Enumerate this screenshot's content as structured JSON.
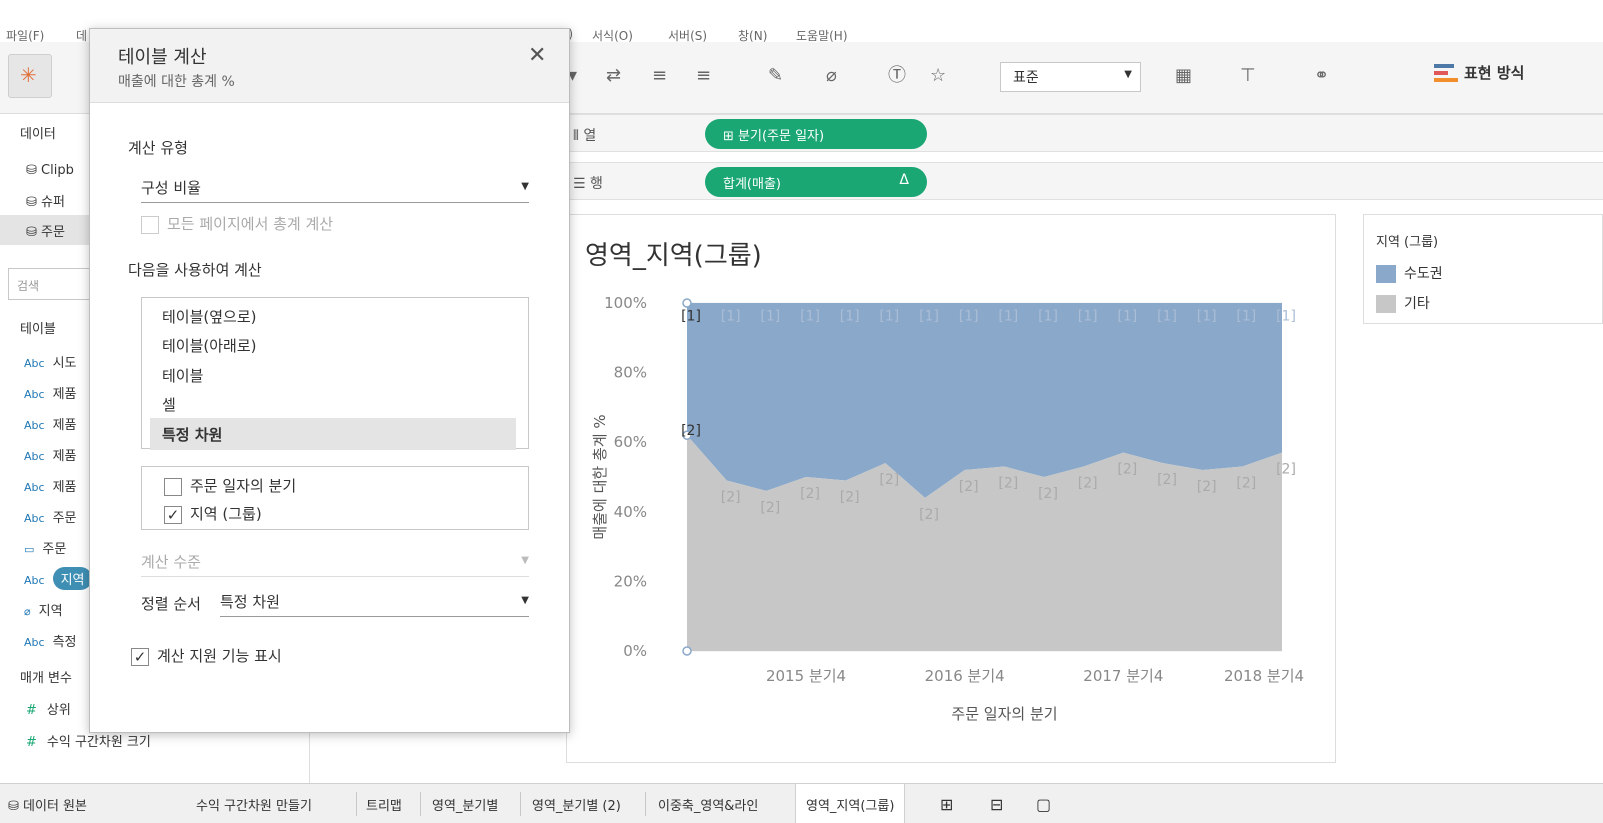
{
  "menu": [
    "파일(F)",
    "데",
    "M)",
    "서식(O)",
    "서버(S)",
    "창(N)",
    "도움말(H)"
  ],
  "toolbar": {
    "fit_select": "표준",
    "show_me": "표현 방식"
  },
  "data_pane": {
    "header": "데이터",
    "sources": [
      "Clipb",
      "슈퍼",
      "주문"
    ],
    "search_placeholder": "검색",
    "tables_header": "테이블",
    "type_abc": "Abc",
    "fields": [
      "시도",
      "제품",
      "제품",
      "제품",
      "제품",
      "주문",
      "주문",
      "지역",
      "지역",
      "측정"
    ],
    "params_header": "매개 변수",
    "params": [
      "상위",
      "수익 구간차원 크기"
    ]
  },
  "shelves": {
    "columns_label": "열",
    "rows_label": "행",
    "columns_pill": "분기(주문 일자)",
    "rows_pill": "합계(매출)",
    "rows_pill_delta": "Δ"
  },
  "chart_data": {
    "type": "area",
    "title": "영역_지역(그룹)",
    "xlabel": "주문 일자의 분기",
    "ylabel": "매출에 대한 총계 %",
    "yticks": [
      "0%",
      "20%",
      "40%",
      "60%",
      "80%",
      "100%"
    ],
    "xticks": [
      "2015 분기4",
      "2016 분기4",
      "2017 분기4",
      "2018 분기4"
    ],
    "ylim": [
      0,
      100
    ],
    "x_count": 16,
    "series": [
      {
        "name": "기타",
        "color": "#c7c7c7",
        "label": "[2]",
        "values": [
          62,
          49,
          46,
          50,
          49,
          54,
          44,
          52,
          53,
          50,
          53,
          57,
          54,
          52,
          53,
          57
        ]
      },
      {
        "name": "수도권",
        "color": "#8aa8c9",
        "label": "[1]",
        "values": [
          38,
          51,
          54,
          50,
          51,
          46,
          56,
          48,
          47,
          50,
          47,
          43,
          46,
          48,
          47,
          43
        ]
      }
    ]
  },
  "legend": {
    "title": "지역 (그룹)",
    "items": [
      {
        "label": "수도권",
        "color": "#8aa8c9"
      },
      {
        "label": "기타",
        "color": "#c7c7c7"
      }
    ]
  },
  "tabs": [
    "데이터 원본",
    "수익 구간차원 만들기",
    "트리맵",
    "영역_분기별",
    "영역_분기별 (2)",
    "이중축_영역&라인",
    "영역_지역(그룹)"
  ],
  "dialog": {
    "title": "테이블 계산",
    "subtitle": "매출에 대한 총계 %",
    "calc_type_label": "계산 유형",
    "calc_type": "구성 비율",
    "all_pages_label": "모든 페이지에서 총계 계산",
    "compute_using_label": "다음을 사용하여 계산",
    "compute_options": [
      "테이블(옆으로)",
      "테이블(아래로)",
      "테이블",
      "셀",
      "특정 차원"
    ],
    "dimensions": [
      {
        "label": "주문 일자의 분기",
        "checked": false
      },
      {
        "label": "지역 (그룹)",
        "checked": true
      }
    ],
    "level_label": "계산 수준",
    "sort_label": "정렬 순서",
    "sort_value": "특정 차원",
    "show_assist_label": "계산 지원 기능 표시",
    "checkmark": "✓"
  }
}
